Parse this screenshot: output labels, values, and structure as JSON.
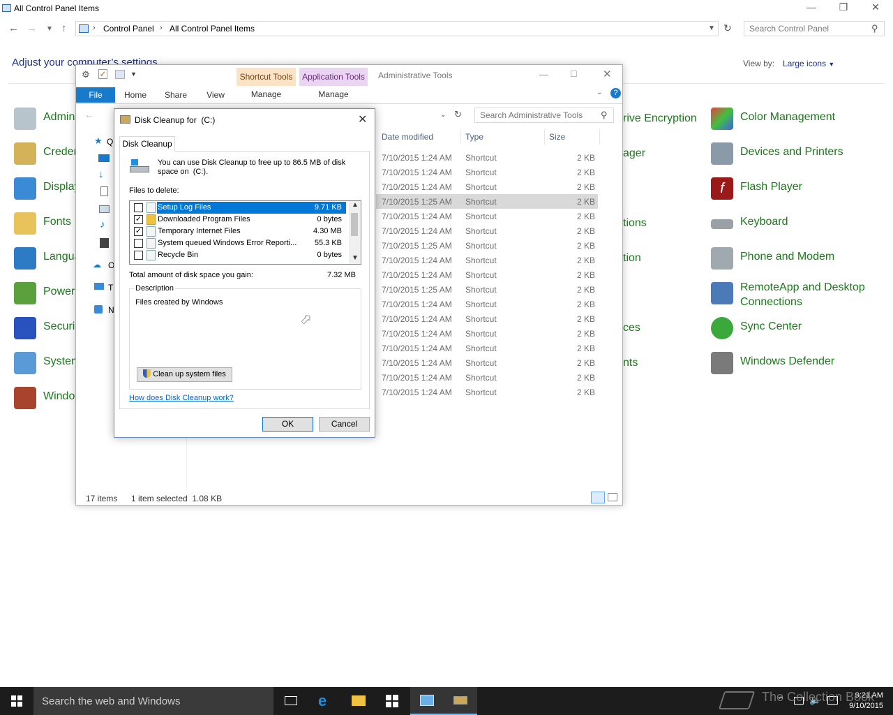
{
  "control_panel": {
    "title": "All Control Panel Items",
    "breadcrumb": [
      "Control Panel",
      "All Control Panel Items"
    ],
    "search_placeholder": "Search Control Panel",
    "heading": "Adjust your computer’s settings",
    "view_by_label": "View by:",
    "view_by_value": "Large icons",
    "left_items": [
      "Admin",
      "Creden",
      "Display",
      "Fonts",
      "Langua",
      "Power",
      "Securi",
      "System",
      "Windo"
    ],
    "middle_items_visible": [
      "rive Encryption",
      "ager",
      "tions",
      "tion",
      "ces",
      "nts"
    ],
    "right_items": [
      "Color Management",
      "Devices and Printers",
      "Flash Player",
      "Keyboard",
      "Phone and Modem",
      "RemoteApp and Desktop",
      "Connections",
      "Sync Center",
      "Windows Defender"
    ],
    "colors": {
      "link_green": "#1a7a1a",
      "heading_blue": "#1e3287"
    }
  },
  "explorer": {
    "title": "Administrative Tools",
    "tabs": {
      "file": "File",
      "home": "Home",
      "share": "Share",
      "view": "View"
    },
    "context_tabs": {
      "shortcut_tools": "Shortcut Tools",
      "application_tools": "Application Tools",
      "manage": "Manage"
    },
    "search_placeholder": "Search Administrative Tools",
    "nav_visible": [
      "Q",
      "O",
      "Tl",
      "N"
    ],
    "columns": {
      "date": "Date modified",
      "type": "Type",
      "size": "Size"
    },
    "rows": [
      {
        "date": "7/10/2015 1:24 AM",
        "type": "Shortcut",
        "size": "2 KB"
      },
      {
        "date": "7/10/2015 1:24 AM",
        "type": "Shortcut",
        "size": "2 KB"
      },
      {
        "date": "7/10/2015 1:24 AM",
        "type": "Shortcut",
        "size": "2 KB"
      },
      {
        "date": "7/10/2015 1:25 AM",
        "type": "Shortcut",
        "size": "2 KB"
      },
      {
        "date": "7/10/2015 1:24 AM",
        "type": "Shortcut",
        "size": "2 KB"
      },
      {
        "date": "7/10/2015 1:24 AM",
        "type": "Shortcut",
        "size": "2 KB"
      },
      {
        "date": "7/10/2015 1:25 AM",
        "type": "Shortcut",
        "size": "2 KB"
      },
      {
        "date": "7/10/2015 1:24 AM",
        "type": "Shortcut",
        "size": "2 KB"
      },
      {
        "date": "7/10/2015 1:24 AM",
        "type": "Shortcut",
        "size": "2 KB"
      },
      {
        "date": "7/10/2015 1:25 AM",
        "type": "Shortcut",
        "size": "2 KB"
      },
      {
        "date": "7/10/2015 1:24 AM",
        "type": "Shortcut",
        "size": "2 KB"
      },
      {
        "date": "7/10/2015 1:24 AM",
        "type": "Shortcut",
        "size": "2 KB"
      },
      {
        "date": "7/10/2015 1:24 AM",
        "type": "Shortcut",
        "size": "2 KB"
      },
      {
        "date": "7/10/2015 1:24 AM",
        "type": "Shortcut",
        "size": "2 KB"
      },
      {
        "date": "7/10/2015 1:24 AM",
        "type": "Shortcut",
        "size": "2 KB"
      },
      {
        "date": "7/10/2015 1:24 AM",
        "type": "Shortcut",
        "size": "2 KB"
      },
      {
        "date": "7/10/2015 1:24 AM",
        "type": "Shortcut",
        "size": "2 KB"
      }
    ],
    "selected_row": 3,
    "status": {
      "items": "17 items",
      "selection": "1 item selected  1.08 KB"
    }
  },
  "dialog": {
    "title": "Disk Cleanup for  (C:)",
    "tab": "Disk Cleanup",
    "intro": "You can use Disk Cleanup to free up to 86.5 MB of disk space on  (C:).",
    "files_to_delete_label": "Files to delete:",
    "files": [
      {
        "name": "Setup Log Files",
        "size": "9.71 KB",
        "checked": false
      },
      {
        "name": "Downloaded Program Files",
        "size": "0 bytes",
        "checked": true
      },
      {
        "name": "Temporary Internet Files",
        "size": "4.30 MB",
        "checked": true
      },
      {
        "name": "System queued Windows Error Reporti...",
        "size": "55.3 KB",
        "checked": false
      },
      {
        "name": "Recycle Bin",
        "size": "0 bytes",
        "checked": false
      }
    ],
    "selected_file": 0,
    "total_label": "Total amount of disk space you gain:",
    "total_value": "7.32 MB",
    "description_label": "Description",
    "description_text": "Files created by Windows",
    "cleanup_system_button": "Clean up system files",
    "help_link": "How does Disk Cleanup work?",
    "ok": "OK",
    "cancel": "Cancel"
  },
  "taskbar": {
    "search_placeholder": "Search the web and Windows",
    "time": "9:21 AM",
    "date": "9/10/2015"
  },
  "watermark": "The Collection Book"
}
